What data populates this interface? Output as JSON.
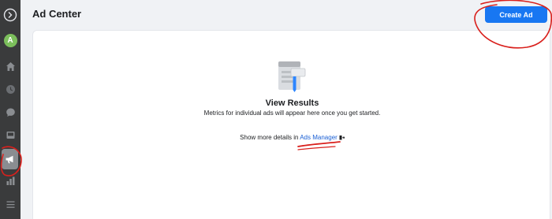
{
  "header": {
    "title": "Ad Center",
    "create_label": "Create Ad"
  },
  "rail": {
    "avatar_initial": "A",
    "items": [
      {
        "icon": "logo-icon"
      },
      {
        "icon": "avatar"
      },
      {
        "icon": "home-icon"
      },
      {
        "icon": "clock-icon"
      },
      {
        "icon": "chat-bubble-icon"
      },
      {
        "icon": "inbox-icon"
      },
      {
        "icon": "megaphone-icon",
        "active": true
      },
      {
        "icon": "bar-chart-icon"
      },
      {
        "icon": "menu-icon"
      }
    ]
  },
  "empty_state": {
    "title": "View Results",
    "description": "Metrics for individual ads will appear here once you get started.",
    "details_prefix": "Show more details in",
    "link_label": "Ads Manager"
  },
  "colors": {
    "accent": "#1877f2",
    "link": "#1a5fd4",
    "annotation": "#d9201c",
    "rail": "#3a3b3c"
  }
}
